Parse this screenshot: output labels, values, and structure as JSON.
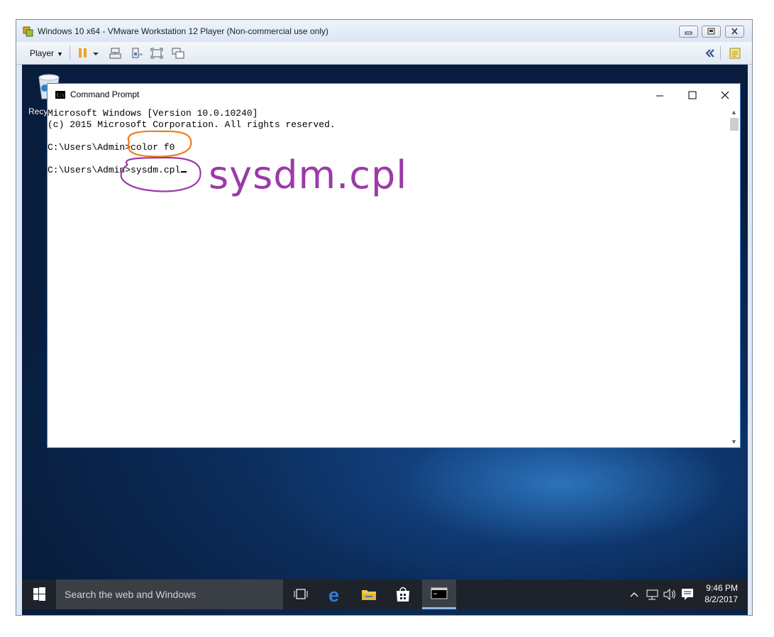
{
  "vmware": {
    "title": "Windows 10 x64 - VMware Workstation 12 Player (Non-commercial use only)",
    "player_menu": "Player"
  },
  "desktop": {
    "recycle_bin_label": "Recycl"
  },
  "cmd": {
    "title": "Command Prompt",
    "lines": [
      "Microsoft Windows [Version 10.0.10240]",
      "(c) 2015 Microsoft Corporation. All rights reserved.",
      "",
      "C:\\Users\\Admin>color f0",
      "",
      "C:\\Users\\Admin>sysdm.cpl"
    ],
    "controls": {
      "minimize": "─",
      "maximize": "☐",
      "close": "✕"
    }
  },
  "annotation": {
    "handwritten_text": "sysdm.cpl",
    "highlight_colors": [
      "#f07d1c",
      "#9b3aa8"
    ]
  },
  "taskbar": {
    "search_placeholder": "Search the web and Windows",
    "time": "9:46 PM",
    "date": "8/2/2017"
  },
  "colors": {
    "desktop": "#0b2b58",
    "taskbar": "#1e232b",
    "pause_orange": "#f0a030"
  }
}
